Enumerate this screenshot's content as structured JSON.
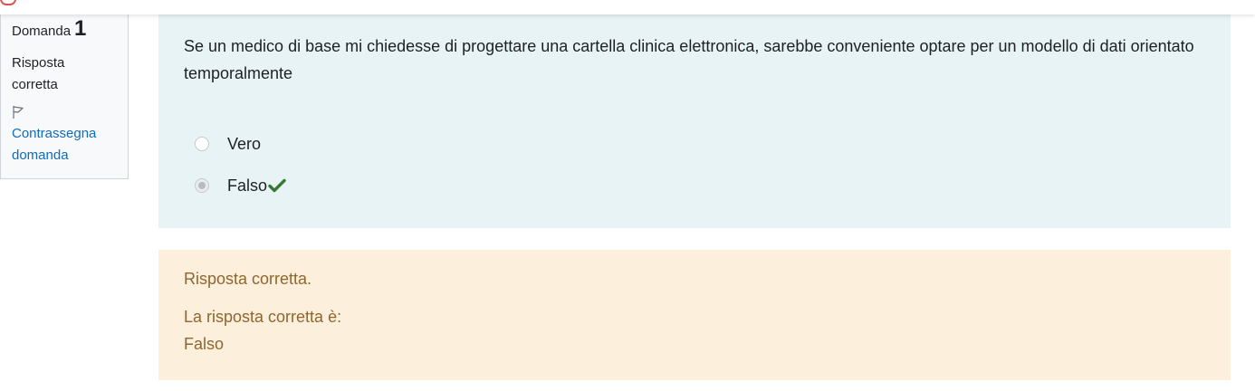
{
  "info": {
    "question_label": "Domanda",
    "question_number": "1",
    "state_line1": "Risposta",
    "state_line2": "corretta",
    "flag_line1": "Contrassegna",
    "flag_line2": "domanda",
    "flag_icon": "flag-icon"
  },
  "question": {
    "text": "Se un medico di base mi chiedesse di progettare una cartella clinica elettronica, sarebbe conveniente optare per un modello di dati orientato temporalmente",
    "answers": [
      {
        "label": "Vero",
        "selected": false
      },
      {
        "label": "Falso",
        "selected": true,
        "mark": "check-icon",
        "mark_color": "#357a32"
      }
    ]
  },
  "feedback": {
    "general": "Risposta corretta.",
    "right_answer_title": "La risposta corretta è:",
    "right_answer_value": "Falso"
  },
  "colors": {
    "info_link": "#0f6cbf",
    "question_bg": "#e7f3f5",
    "feedback_bg": "#fcefdc",
    "feedback_text": "#8e662e"
  }
}
